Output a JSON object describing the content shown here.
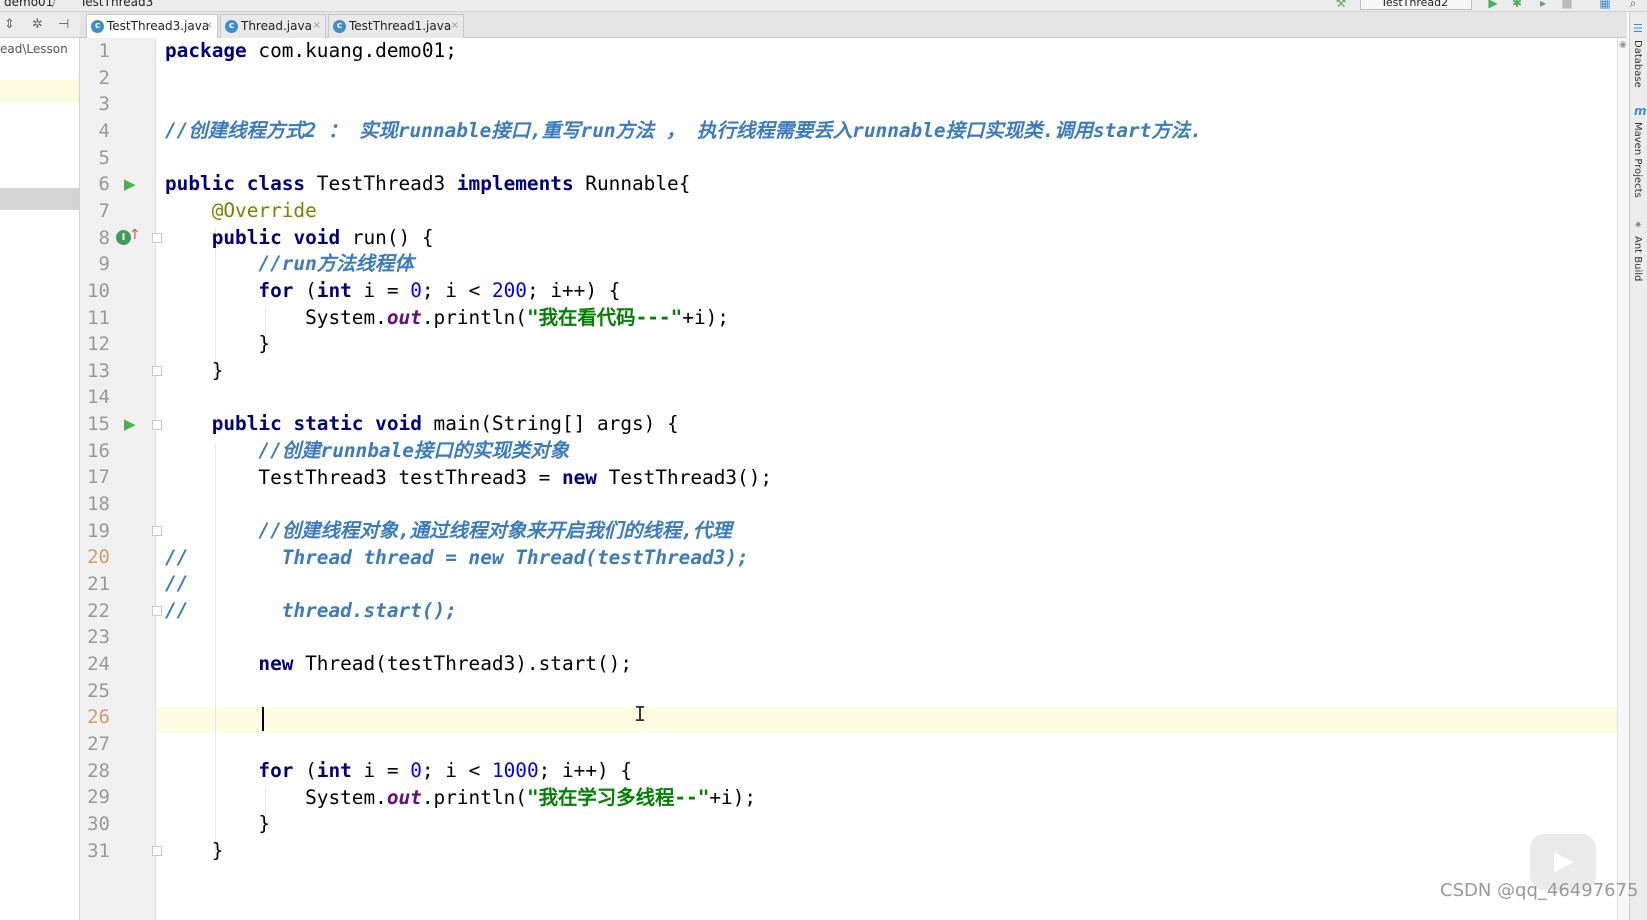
{
  "topbar": {
    "breadcrumb_project": "demo01",
    "breadcrumb_separator": "/",
    "breadcrumb_file": "TestThread3",
    "run_config": "TestThread2",
    "icons": [
      "run-icon",
      "debug-icon",
      "coverage-icon",
      "stop-icon",
      "project-structure-icon",
      "search-icon"
    ]
  },
  "project_panel": {
    "path_text": "ead\\Lesson",
    "toolbar_icons": [
      "collapse-all-icon",
      "settings-icon",
      "hide-icon"
    ]
  },
  "tabs": [
    {
      "label": "TestThread3.java",
      "active": true,
      "icon": "java-class-icon"
    },
    {
      "label": "Thread.java",
      "active": false,
      "icon": "java-class-icon"
    },
    {
      "label": "TestThread1.java",
      "active": false,
      "icon": "java-class-icon"
    }
  ],
  "colors": {
    "keyword": "#000080",
    "comment": "#3b7bbf",
    "number": "#0000ff",
    "string": "#008000",
    "field": "#660e7a",
    "annotation": "#808000",
    "current_line": "#fdfbe0"
  },
  "code": {
    "line_numbers": [
      "1",
      "2",
      "3",
      "4",
      "5",
      "6",
      "7",
      "8",
      "9",
      "10",
      "11",
      "12",
      "13",
      "14",
      "15",
      "16",
      "17",
      "18",
      "19",
      "20",
      "21",
      "22",
      "23",
      "24",
      "25",
      "26",
      "27",
      "28",
      "29",
      "30",
      "31"
    ],
    "l1": {
      "kw": "package",
      "rest": " com.kuang.demo01;"
    },
    "l4": {
      "cm": "//创建线程方式2 ： 实现runnable接口,重写run方法 ， 执行线程需要丢入runnable接口实现类.调用start方法."
    },
    "l6": {
      "kw1": "public",
      "kw2": "class",
      "name": " TestThread3 ",
      "kw3": "implements",
      "rest": " Runnable{"
    },
    "l7": {
      "ann": "@Override"
    },
    "l8": {
      "kw1": "public",
      "kw2": "void",
      "rest": " run() {"
    },
    "l9": {
      "cm": "//run方法线程体"
    },
    "l10": {
      "kw": "for",
      "p1": " (",
      "kw2": "int",
      "p2": " i = ",
      "n1": "0",
      "p3": "; i < ",
      "n2": "200",
      "p4": "; i++) {"
    },
    "l11": {
      "p1": "System.",
      "fld": "out",
      "p2": ".println(",
      "str": "\"我在看代码---\"",
      "p3": "+i);"
    },
    "l12": {
      "rest": "}"
    },
    "l13": {
      "rest": "}"
    },
    "l15": {
      "kw1": "public",
      "kw2": "static",
      "kw3": "void",
      "rest": " main(String[] args) {"
    },
    "l16": {
      "cm": "//创建runnbale接口的实现类对象"
    },
    "l17": {
      "p1": "TestThread3 testThread3 = ",
      "kw": "new",
      "p2": " TestThread3();"
    },
    "l19": {
      "cm": "//创建线程对象,通过线程对象来开启我们的线程,代理"
    },
    "l20": {
      "pre": "//",
      "cm": "Thread thread = new Thread(testThread3);"
    },
    "l21": {
      "pre": "//"
    },
    "l22": {
      "pre": "//",
      "cm": "thread.start();"
    },
    "l24": {
      "kw": "new",
      "rest": " Thread(testThread3).start();"
    },
    "l28": {
      "kw": "for",
      "p1": " (",
      "kw2": "int",
      "p2": " i = ",
      "n1": "0",
      "p3": "; i < ",
      "n2": "1000",
      "p4": "; i++) {"
    },
    "l29": {
      "p1": "System.",
      "fld": "out",
      "p2": ".println(",
      "str": "\"我在学习多线程--\"",
      "p3": "+i);"
    },
    "l30": {
      "rest": "}"
    },
    "l31": {
      "rest": "}"
    }
  },
  "right_strip": {
    "database": "Database",
    "maven_mark": "m",
    "maven": "Maven Projects",
    "ant": "Ant Build"
  },
  "watermark": "CSDN @qq_46497675"
}
